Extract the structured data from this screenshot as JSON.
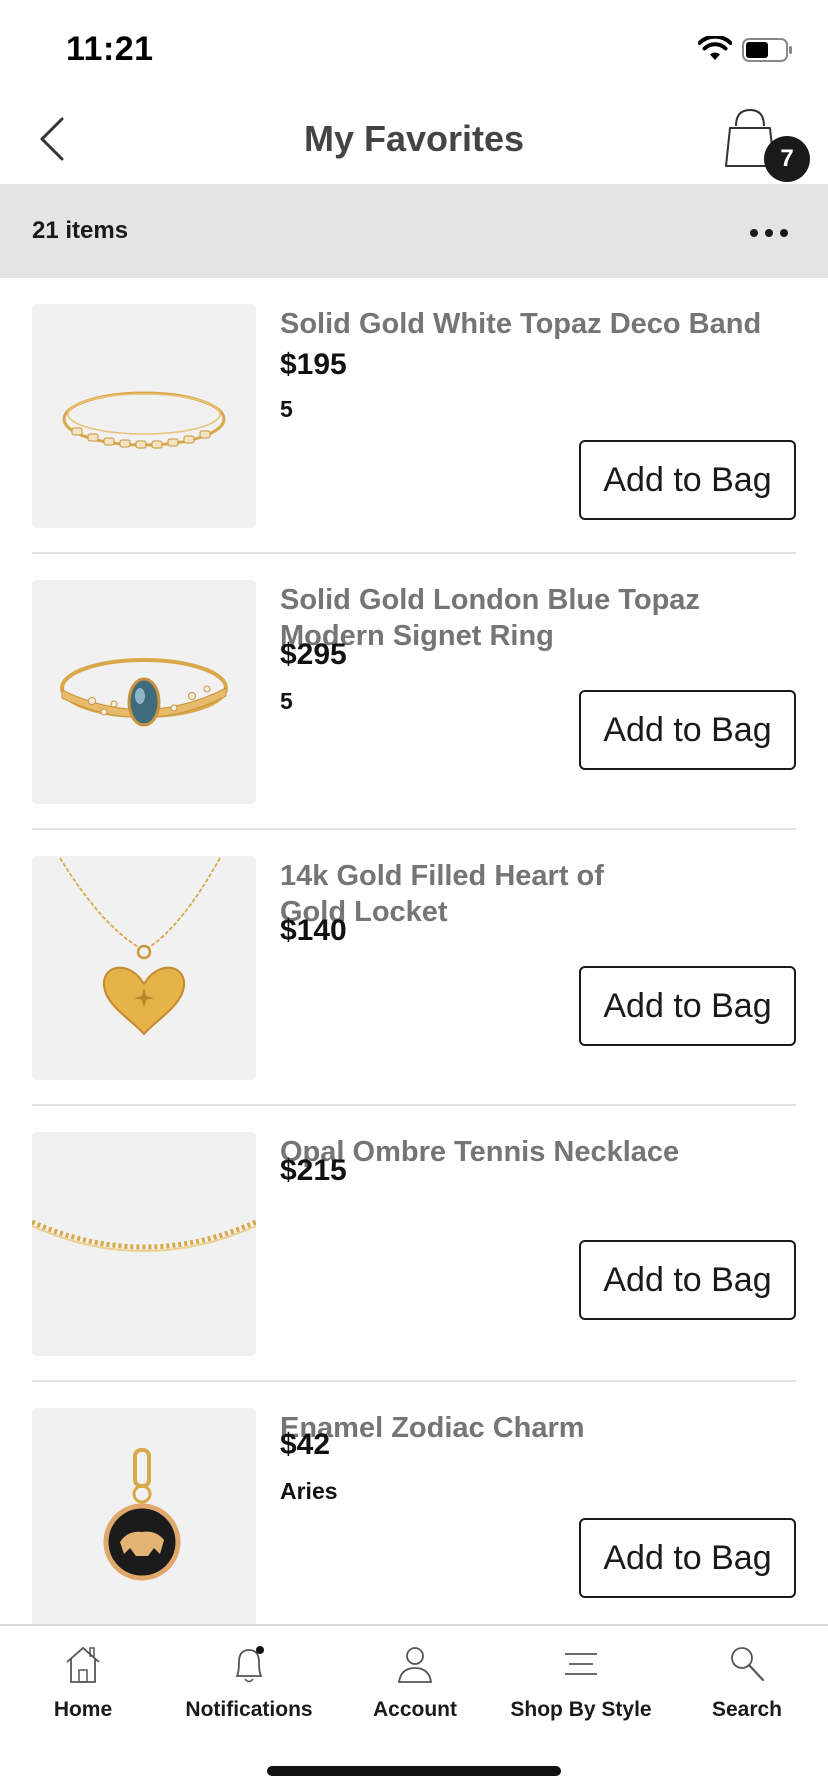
{
  "status_bar": {
    "time": "11:21"
  },
  "nav": {
    "title": "My Favorites",
    "bag_count": "7"
  },
  "info_bar": {
    "items_count": "21 items"
  },
  "favorites": [
    {
      "name": "Solid Gold White Topaz Deco Band",
      "price": "$195",
      "option": "5",
      "button": "Add to Bag",
      "image_icon": "ring-band-icon"
    },
    {
      "name": "Solid Gold London Blue Topaz Modern Signet Ring",
      "price": "$295",
      "option": "5",
      "button": "Add to Bag",
      "image_icon": "signet-ring-icon"
    },
    {
      "name": "14k Gold Filled Heart of Gold Locket",
      "price": "$140",
      "option": "",
      "button": "Add to Bag",
      "image_icon": "heart-locket-icon"
    },
    {
      "name": "Opal Ombre Tennis Necklace",
      "price": "$215",
      "option": "",
      "button": "Add to Bag",
      "image_icon": "tennis-necklace-icon"
    },
    {
      "name": "Enamel Zodiac Charm",
      "price": "$42",
      "option": "Aries",
      "button": "Add to Bag",
      "image_icon": "zodiac-charm-icon"
    }
  ],
  "tabs": [
    {
      "label": "Home",
      "icon": "home-icon"
    },
    {
      "label": "Notifications",
      "icon": "bell-icon"
    },
    {
      "label": "Account",
      "icon": "person-icon"
    },
    {
      "label": "Shop By Style",
      "icon": "lines-icon"
    },
    {
      "label": "Search",
      "icon": "search-icon"
    }
  ],
  "colors": {
    "accent": "#1a1a1a",
    "info_bar_bg": "#e4e4e4",
    "item_name": "#757575",
    "thumb_bg": "#f1f1f1",
    "gold": "#d9a84a"
  }
}
